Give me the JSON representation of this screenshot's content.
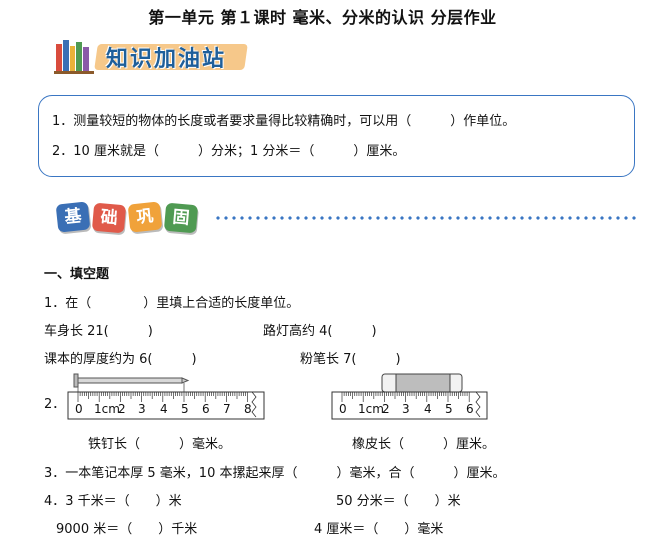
{
  "title": "第一单元  第１课时  毫米、分米的认识  分层作业",
  "banner1": "知识加油站",
  "knowledge": [
    "1．测量较短的物体的长度或者要求量得比较精确时，可以用（　　　）作单位。",
    "2．10 厘米就是（　　　）分米；1 分米＝（　　　）厘米。"
  ],
  "banner2": [
    "基",
    "础",
    "巩",
    "固"
  ],
  "section_title": "一、填空题",
  "q1": {
    "stem": "1．在（　　　　）里填上合适的长度单位。",
    "items": [
      "车身长 21(　　　)",
      "路灯高约 4(　　　)",
      "课本的厚度约为 6(　　　)",
      "粉笔长 7(　　　)"
    ]
  },
  "q2": {
    "num": "2．",
    "ruler1_ticks": [
      "0",
      "1cm",
      "2",
      "3",
      "4",
      "5",
      "6",
      "7",
      "8"
    ],
    "ruler2_ticks": [
      "0",
      "1cm",
      "2",
      "3",
      "4",
      "5",
      "6"
    ],
    "ans1": "铁钉长（　　　）毫米。",
    "ans2": "橡皮长（　　　）厘米。"
  },
  "q3": "3．一本笔记本厚 5 毫米，10 本摞起来厚（　　　）毫米，合（　　　）厘米。",
  "q4": [
    "4．3 千米＝（　　）米",
    "50 分米＝（　　）米",
    "9000 米＝（　　）千米",
    "4 厘米＝（　　）毫米"
  ]
}
